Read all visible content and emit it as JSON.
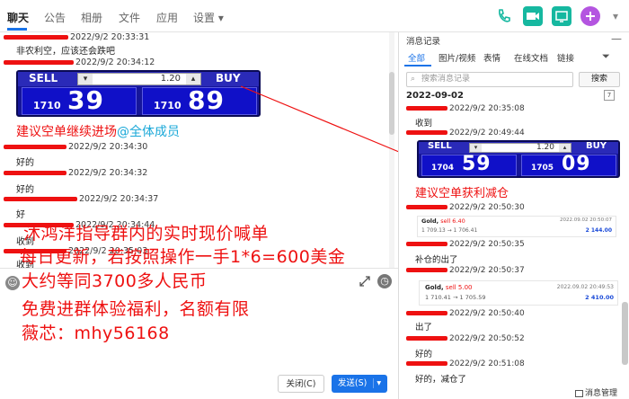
{
  "tabs": [
    "聊天",
    "公告",
    "相册",
    "文件",
    "应用",
    "设置 ▾"
  ],
  "icons": {
    "phone": "phone-icon",
    "video": "video-icon",
    "screen": "screen-share-icon",
    "add": "add-icon"
  },
  "chat": {
    "messages": [
      {
        "time": "2022/9/2 20:33:31",
        "text": "非农利空，应该还会跌吧"
      },
      {
        "time": "2022/9/2 20:34:12",
        "text": ""
      },
      {
        "time": "2022/9/2 20:34:30",
        "text": "好的"
      },
      {
        "time": "2022/9/2 20:34:32",
        "text": "好的"
      },
      {
        "time": "2022/9/2 20:34:37",
        "text": "好"
      },
      {
        "time": "2022/9/2 20:34:44",
        "text": "收到"
      },
      {
        "time": "2022/9/2 20:35:03",
        "text": "收到"
      }
    ],
    "widget": {
      "sell": "SELL",
      "buy": "BUY",
      "qty": "1.20",
      "sell_small": "1710",
      "sell_big": "39",
      "buy_small": "1710",
      "buy_big": "89"
    },
    "caption": "建议空单继续进场",
    "mention": "@全体成员"
  },
  "ad": {
    "lines": [
      "沐鸿洋指导群内的实时现价喊单",
      "每日更新，若按照操作一手1*6=600美金",
      "大约等同3700多人民币",
      "免费进群体验福利，名额有限",
      "薇芯：mhy56168"
    ]
  },
  "input": {
    "close_label": "关闭(C)",
    "send_label": "发送(S)",
    "send_arrow": "▾"
  },
  "history": {
    "title": "消息记录",
    "close": "—",
    "tabs": [
      "全部",
      "图片/视频",
      "表情",
      "在线文档",
      "链接"
    ],
    "search_placeholder": "搜索消息记录",
    "search_button": "搜索",
    "date": "2022-09-02",
    "items": [
      {
        "time": "2022/9/2 20:35:08",
        "text": "收到"
      },
      {
        "time": "2022/9/2 20:49:44",
        "text": ""
      },
      {
        "time": "2022/9/2 20:50:30",
        "text": ""
      },
      {
        "time": "2022/9/2 20:50:35",
        "text": "补仓的出了"
      },
      {
        "time": "2022/9/2 20:50:37",
        "text": ""
      },
      {
        "time": "2022/9/2 20:50:40",
        "text": "出了"
      },
      {
        "time": "2022/9/2 20:50:52",
        "text": "好的"
      },
      {
        "time": "2022/9/2 20:51:08",
        "text": "好的，减仓了"
      }
    ],
    "widget": {
      "sell": "SELL",
      "buy": "BUY",
      "qty": "1.20",
      "sell_small": "1704",
      "sell_big": "59",
      "buy_small": "1705",
      "buy_big": "09"
    },
    "caption": "建议空单获利减仓",
    "card1": {
      "symbol": "Gold,",
      "action": "sell 6.40",
      "date": "2022.09.02 20:50:07",
      "prices": "1 709.13 → 1 706.41",
      "profit": "2 144.00"
    },
    "card2": {
      "symbol": "Gold,",
      "action": "sell 5.00",
      "date": "2022.09.02 20:49:53",
      "prices": "1 710.41 → 1 705.59",
      "profit": "2 410.00"
    },
    "footer": "消息管理"
  },
  "colors": {
    "accent": "#1a73e8",
    "alert_red": "#ee1111",
    "widget_blue": "#1010c8"
  }
}
